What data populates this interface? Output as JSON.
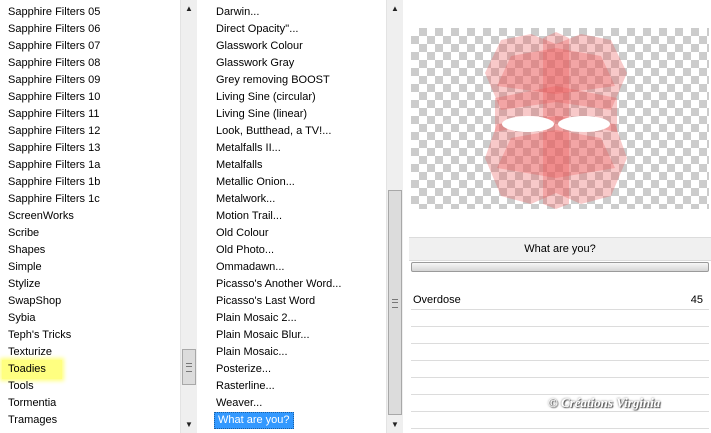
{
  "category_list": {
    "items": [
      "Sapphire Filters 05",
      "Sapphire Filters 06",
      "Sapphire Filters 07",
      "Sapphire Filters 08",
      "Sapphire Filters 09",
      "Sapphire Filters 10",
      "Sapphire Filters 11",
      "Sapphire Filters 12",
      "Sapphire Filters 13",
      "Sapphire Filters 1a",
      "Sapphire Filters 1b",
      "Sapphire Filters 1c",
      "ScreenWorks",
      "Scribe",
      "Shapes",
      "Simple",
      "Stylize",
      "SwapShop",
      "Sybia",
      "Teph's Tricks",
      "Texturize",
      "Toadies",
      "Tools",
      "Tormentia",
      "Tramages"
    ],
    "selected": "Toadies",
    "highlight_color": "#ffff80"
  },
  "filter_list": {
    "items": [
      "Darwin...",
      "Direct Opacity''...",
      "Glasswork Colour",
      "Glasswork Gray",
      "Grey removing BOOST",
      "Living Sine (circular)",
      "Living Sine (linear)",
      "Look, Butthead, a TV!...",
      "Metalfalls II...",
      "Metalfalls",
      "Metallic Onion...",
      "Metalwork...",
      "Motion Trail...",
      "Old Colour",
      "Old Photo...",
      "Ommadawn...",
      "Picasso's Another Word...",
      "Picasso's Last Word",
      "Plain Mosaic 2...",
      "Plain Mosaic Blur...",
      "Plain Mosaic...",
      "Posterize...",
      "Rasterline...",
      "Weaver...",
      "What are you?"
    ],
    "selected": "What are you?",
    "selected_color": "#3399ff"
  },
  "preview": {
    "filter_name": "What are you?"
  },
  "parameters": [
    {
      "label": "Overdose",
      "value": "45"
    }
  ],
  "watermark": "© Créations Virginia",
  "icons": {
    "scroll_up": "▲",
    "scroll_down": "▼"
  }
}
